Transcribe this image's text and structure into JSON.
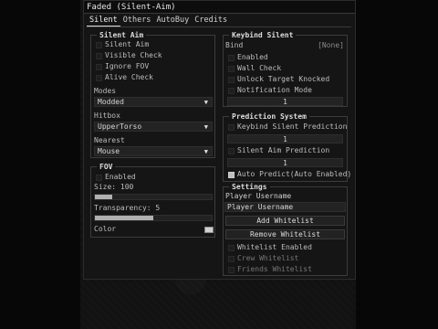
{
  "window": {
    "title": "Faded (Silent-Aim)"
  },
  "tabs": [
    "Silent",
    "Others",
    "AutoBuy",
    "Credits"
  ],
  "silent_aim": {
    "title": "Silent Aim",
    "toggles": [
      {
        "label": "Silent Aim",
        "checked": false
      },
      {
        "label": "Visible Check",
        "checked": false
      },
      {
        "label": "Ignore FOV",
        "checked": false
      },
      {
        "label": "Alive Check",
        "checked": false
      }
    ],
    "modes_label": "Modes",
    "modes_value": "Modded",
    "hitbox_label": "Hitbox",
    "hitbox_value": "UpperTorso",
    "nearest_label": "Nearest",
    "nearest_value": "Mouse"
  },
  "fov": {
    "title": "FOV",
    "enabled_label": "Enabled",
    "enabled_checked": false,
    "size_label": "Size: 100",
    "size_fraction": 0.15,
    "transparency_label": "Transparency: 5",
    "transparency_fraction": 0.5,
    "color_label": "Color",
    "color_value": "#d0d0d0"
  },
  "keybind": {
    "title": "Keybind Silent",
    "bind_label": "Bind",
    "bind_value": "[None]",
    "toggles": [
      {
        "label": "Enabled",
        "checked": false
      },
      {
        "label": "Wall Check",
        "checked": false
      },
      {
        "label": "Unlock Target Knocked",
        "checked": false
      },
      {
        "label": "Notification Mode",
        "checked": false
      }
    ],
    "field_value": "1"
  },
  "prediction": {
    "title": "Prediction System",
    "keybind_label": "Keybind Silent Prediction",
    "keybind_field": "1",
    "silent_label": "Silent Aim Prediction",
    "silent_field": "1",
    "auto_label": "Auto Predict(Auto Enabled)",
    "auto_checked": true
  },
  "settings": {
    "title": "Settings",
    "player_label": "Player Username",
    "player_placeholder": "Player Username",
    "add_whitelist": "Add Whitelist",
    "remove_whitelist": "Remove Whitelist",
    "toggles": [
      {
        "label": "Whitelist Enabled",
        "checked": false
      },
      {
        "label": "Crew Whitelist",
        "checked": false
      },
      {
        "label": "Friends Whitelist",
        "checked": false
      }
    ]
  }
}
